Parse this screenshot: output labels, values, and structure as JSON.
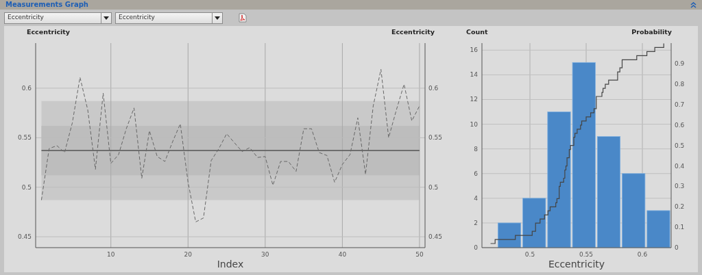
{
  "panel": {
    "title": "Measurements Graph"
  },
  "toolbar": {
    "dropdowns": [
      {
        "value": "Eccentricity"
      },
      {
        "value": "Eccentricity"
      }
    ]
  },
  "line_graph": {
    "left_axis_title": "Eccentricity",
    "right_axis_title": "Eccentricity",
    "chart_data": {
      "type": "line",
      "xlabel": "Index",
      "x": [
        1,
        2,
        3,
        4,
        5,
        6,
        7,
        8,
        9,
        10,
        11,
        12,
        13,
        14,
        15,
        16,
        17,
        18,
        19,
        20,
        21,
        22,
        23,
        24,
        25,
        26,
        27,
        28,
        29,
        30,
        31,
        32,
        33,
        34,
        35,
        36,
        37,
        38,
        39,
        40,
        41,
        42,
        43,
        44,
        45,
        46,
        47,
        48,
        49,
        50
      ],
      "series": [
        {
          "color": "#666666",
          "line_style": "dashed",
          "values": [
            0.487,
            0.539,
            0.542,
            0.535,
            0.565,
            0.611,
            0.578,
            0.518,
            0.595,
            0.524,
            0.533,
            0.559,
            0.58,
            0.509,
            0.557,
            0.531,
            0.526,
            0.546,
            0.564,
            0.505,
            0.465,
            0.469,
            0.527,
            0.539,
            0.554,
            0.545,
            0.536,
            0.54,
            0.53,
            0.531,
            0.502,
            0.526,
            0.526,
            0.516,
            0.559,
            0.559,
            0.535,
            0.532,
            0.505,
            0.523,
            0.533,
            0.57,
            0.513,
            0.582,
            0.619,
            0.55,
            0.578,
            0.604,
            0.567,
            0.582
          ]
        }
      ],
      "xlim": [
        0.25,
        50.45
      ],
      "ylim": [
        0.439,
        0.6455
      ],
      "xticks": [
        10,
        20,
        30,
        40,
        50
      ],
      "yticks": [
        0.45,
        0.5,
        0.55,
        0.6
      ],
      "y2lim": [
        0.439,
        0.6455
      ],
      "y2ticks": [
        0.45,
        0.5,
        0.55,
        0.6
      ],
      "grid": true,
      "bands": [
        {
          "axis": "y",
          "from": 0.487,
          "to": 0.587,
          "color": "#c9c9c9"
        },
        {
          "axis": "y",
          "from": 0.512,
          "to": 0.562,
          "color": "#bdbdbd"
        }
      ],
      "ref_lines": [
        {
          "axis": "y",
          "value": 0.537,
          "color": "#555555"
        }
      ]
    }
  },
  "histogram": {
    "left_axis_title": "Count",
    "right_axis_title": "Probability",
    "chart_data": {
      "type": "bar",
      "xlabel": "Eccentricity",
      "x": [
        0.4817,
        0.5038,
        0.5259,
        0.548,
        0.5701,
        0.5922,
        0.6143
      ],
      "series": [
        {
          "color": "#4a88c8",
          "values": [
            2,
            4,
            11,
            15,
            9,
            6,
            3
          ]
        },
        {
          "type": "step",
          "axis": "y2",
          "color": "#444444",
          "x": [
            0.465,
            0.469,
            0.487,
            0.502,
            0.505,
            0.505,
            0.509,
            0.513,
            0.516,
            0.518,
            0.523,
            0.524,
            0.526,
            0.526,
            0.526,
            0.527,
            0.53,
            0.531,
            0.531,
            0.532,
            0.533,
            0.533,
            0.535,
            0.535,
            0.536,
            0.539,
            0.539,
            0.54,
            0.542,
            0.545,
            0.546,
            0.55,
            0.554,
            0.557,
            0.559,
            0.559,
            0.559,
            0.564,
            0.565,
            0.567,
            0.57,
            0.578,
            0.578,
            0.58,
            0.582,
            0.582,
            0.595,
            0.604,
            0.611,
            0.619
          ],
          "values": [
            0.02,
            0.04,
            0.06,
            0.08,
            0.1,
            0.12,
            0.14,
            0.16,
            0.18,
            0.2,
            0.22,
            0.24,
            0.26,
            0.28,
            0.3,
            0.32,
            0.34,
            0.36,
            0.38,
            0.4,
            0.42,
            0.44,
            0.46,
            0.48,
            0.5,
            0.52,
            0.54,
            0.56,
            0.58,
            0.6,
            0.62,
            0.64,
            0.66,
            0.68,
            0.7,
            0.72,
            0.74,
            0.76,
            0.78,
            0.8,
            0.82,
            0.84,
            0.86,
            0.88,
            0.9,
            0.92,
            0.94,
            0.96,
            0.98,
            1
          ]
        }
      ],
      "xlim": [
        0.4573,
        0.6256
      ],
      "ylim": [
        0,
        16.57
      ],
      "xticks": [
        0.5,
        0.55,
        0.6
      ],
      "yticks": [
        0,
        2,
        4,
        6,
        8,
        10,
        12,
        14,
        16
      ],
      "y2lim": [
        0,
        1.0013
      ],
      "y2ticks": [
        0,
        0.1,
        0.2,
        0.3,
        0.4,
        0.5,
        0.6,
        0.7,
        0.8,
        0.9
      ],
      "grid": true
    }
  }
}
